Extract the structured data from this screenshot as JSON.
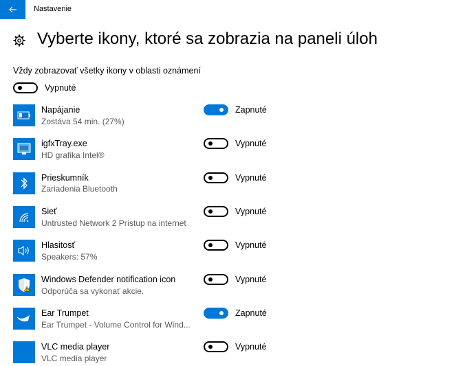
{
  "window": {
    "title": "Nastavenie"
  },
  "page": {
    "title": "Vyberte ikony, ktoré sa zobrazia na paneli úloh"
  },
  "always_show": {
    "label": "Vždy zobrazovať všetky ikony v oblasti oznámení",
    "state": "Vypnuté",
    "on": false
  },
  "rows": [
    {
      "name": "Napájanie",
      "sub": "Zostáva 54 min. (27%)",
      "state": "Zapnuté",
      "on": true,
      "icon": "battery-icon"
    },
    {
      "name": "igfxTray.exe",
      "sub": "HD grafika Intel®",
      "state": "Vypnuté",
      "on": false,
      "icon": "intel-graphics-icon"
    },
    {
      "name": "Prieskumník",
      "sub": "Zariadenia Bluetooth",
      "state": "Vypnuté",
      "on": false,
      "icon": "bluetooth-icon"
    },
    {
      "name": "Sieť",
      "sub": "Untrusted Network  2 Prístup na internet",
      "state": "Vypnuté",
      "on": false,
      "icon": "wifi-icon"
    },
    {
      "name": "Hlasitosť",
      "sub": "Speakers: 57%",
      "state": "Vypnuté",
      "on": false,
      "icon": "speaker-icon"
    },
    {
      "name": "Windows Defender notification icon",
      "sub": "Odporúča sa vykonať akcie.",
      "state": "Vypnuté",
      "on": false,
      "icon": "defender-shield-icon"
    },
    {
      "name": "Ear Trumpet",
      "sub": "Ear Trumpet - Volume Control for Wind...",
      "state": "Zapnuté",
      "on": true,
      "icon": "ear-trumpet-icon"
    },
    {
      "name": "VLC media player",
      "sub": "VLC media player",
      "state": "Vypnuté",
      "on": false,
      "icon": "vlc-icon"
    }
  ]
}
